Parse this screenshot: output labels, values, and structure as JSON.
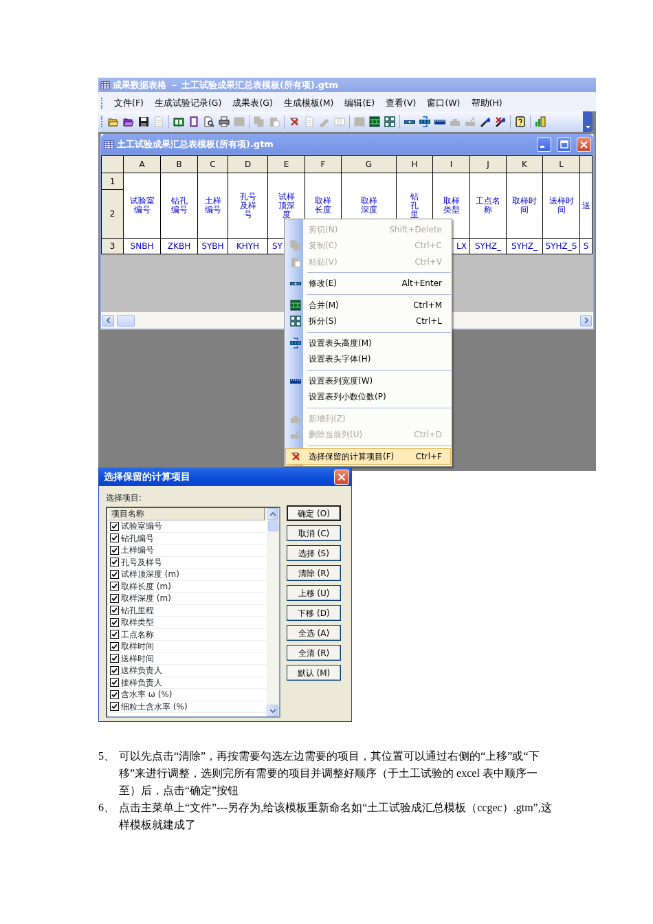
{
  "window": {
    "title": "成果数据表格 － 土工试验成果汇总表模板(所有项).gtm"
  },
  "menu_bar": [
    "文件(F)",
    "生成试验记录(G)",
    "成果表(G)",
    "生成模板(M)",
    "编辑(E)",
    "查看(V)",
    "窗口(W)",
    "帮助(H)"
  ],
  "toolbar": [
    {
      "kind": "button",
      "disabled": false
    },
    {
      "kind": "button",
      "disabled": false
    },
    {
      "kind": "button",
      "disabled": false
    },
    {
      "kind": "button",
      "disabled": true
    },
    {
      "kind": "separator"
    },
    {
      "kind": "button",
      "disabled": false
    },
    {
      "kind": "button",
      "disabled": false
    },
    {
      "kind": "button",
      "disabled": false
    },
    {
      "kind": "button",
      "disabled": false
    },
    {
      "kind": "button",
      "disabled": true
    },
    {
      "kind": "separator"
    },
    {
      "kind": "button",
      "disabled": true
    },
    {
      "kind": "button",
      "disabled": true
    },
    {
      "kind": "separator"
    },
    {
      "kind": "button",
      "disabled": false
    },
    {
      "kind": "button",
      "disabled": true
    },
    {
      "kind": "button",
      "disabled": true
    },
    {
      "kind": "button",
      "disabled": true
    },
    {
      "kind": "separator"
    },
    {
      "kind": "button",
      "disabled": true
    },
    {
      "kind": "button",
      "disabled": false
    },
    {
      "kind": "button",
      "disabled": false
    },
    {
      "kind": "separator"
    },
    {
      "kind": "button",
      "disabled": false
    },
    {
      "kind": "button",
      "disabled": false
    },
    {
      "kind": "button",
      "disabled": false
    },
    {
      "kind": "button",
      "disabled": true
    },
    {
      "kind": "button",
      "disabled": true
    },
    {
      "kind": "button",
      "disabled": false
    },
    {
      "kind": "button",
      "disabled": false
    },
    {
      "kind": "separator"
    },
    {
      "kind": "button",
      "disabled": false
    },
    {
      "kind": "separator"
    },
    {
      "kind": "button",
      "disabled": false
    }
  ],
  "document_window": {
    "title": "土工试验成果汇总表模板(所有项).gtm",
    "grid": {
      "column_letters": [
        "A",
        "B",
        "C",
        "D",
        "E",
        "F",
        "G",
        "H",
        "I",
        "J",
        "K",
        "L"
      ],
      "row_numbers": [
        "1",
        "2",
        "3"
      ],
      "header_cells": [
        "试验室编号",
        "钻孔编号",
        "土样编号",
        "孔号及样号",
        "试样顶深度",
        "取样长度",
        "取样深度",
        "钻孔里",
        "取样类型",
        "工点名称",
        "取样时间",
        "送样时间",
        "送"
      ],
      "row_3": {
        "A": "SNBH",
        "B": "ZKBH",
        "C": "SYBH",
        "D": "KHYH",
        "E": "SY",
        "I": "LX",
        "J": "SYHZ_",
        "K": "SYHZ_",
        "L": "SYHZ_S",
        "column_13": "S"
      }
    }
  },
  "context_menu": [
    {
      "kind": "item",
      "label": "剪切(N)",
      "shortcut": "Shift+Delete",
      "disabled": true,
      "selected": false
    },
    {
      "kind": "item",
      "label": "复制(C)",
      "shortcut": "Ctrl+C",
      "disabled": true,
      "selected": false
    },
    {
      "kind": "item",
      "label": "粘贴(V)",
      "shortcut": "Ctrl+V",
      "disabled": true,
      "selected": false
    },
    {
      "kind": "separator"
    },
    {
      "kind": "item",
      "label": "修改(E)",
      "shortcut": "Alt+Enter",
      "disabled": false,
      "selected": false
    },
    {
      "kind": "separator"
    },
    {
      "kind": "item",
      "label": "合并(M)",
      "shortcut": "Ctrl+M",
      "disabled": false,
      "selected": false
    },
    {
      "kind": "item",
      "label": "拆分(S)",
      "shortcut": "Ctrl+L",
      "disabled": false,
      "selected": false
    },
    {
      "kind": "separator"
    },
    {
      "kind": "item",
      "label": "设置表头高度(M)",
      "disabled": false,
      "selected": false
    },
    {
      "kind": "item",
      "label": "设置表头字体(H)",
      "disabled": false,
      "selected": false
    },
    {
      "kind": "separator"
    },
    {
      "kind": "item",
      "label": "设置表列宽度(W)",
      "disabled": false,
      "selected": false
    },
    {
      "kind": "item",
      "label": "设置表列小数位数(P)",
      "disabled": false,
      "selected": false
    },
    {
      "kind": "separator"
    },
    {
      "kind": "item",
      "label": "新增列(Z)",
      "disabled": true,
      "selected": false
    },
    {
      "kind": "item",
      "label": "删除当前列(U)",
      "shortcut": "Ctrl+D",
      "disabled": true,
      "selected": false
    },
    {
      "kind": "separator"
    },
    {
      "kind": "item",
      "label": "选择保留的计算项目(F)",
      "shortcut": "Ctrl+F",
      "disabled": false,
      "selected": true
    }
  ],
  "dialog": {
    "title": "选择保留的计算项目",
    "prompt": "选择项目:",
    "list_header": "项目名称",
    "items": [
      {
        "label": "试验室编号",
        "checked": true
      },
      {
        "label": "钻孔编号",
        "checked": true
      },
      {
        "label": "土样编号",
        "checked": true
      },
      {
        "label": "孔号及样号",
        "checked": true
      },
      {
        "label": "试样顶深度 (m)",
        "checked": true
      },
      {
        "label": "取样长度 (m)",
        "checked": true
      },
      {
        "label": "取样深度 (m)",
        "checked": true
      },
      {
        "label": "钻孔里程",
        "checked": true
      },
      {
        "label": "取样类型",
        "checked": true
      },
      {
        "label": "工点名称",
        "checked": true
      },
      {
        "label": "取样时间",
        "checked": true
      },
      {
        "label": "送样时间",
        "checked": true
      },
      {
        "label": "送样负责人",
        "checked": true
      },
      {
        "label": "接样负责人",
        "checked": true
      },
      {
        "label": "含水率 ω (%)",
        "checked": true
      },
      {
        "label": "细粒土含水率 (%)",
        "checked": true
      }
    ],
    "buttons": [
      {
        "label": "确定 (O)",
        "default": true
      },
      {
        "label": "取消 (C)",
        "default": false
      },
      {
        "label": "选择 (S)",
        "default": false
      },
      {
        "label": "清除 (R)",
        "default": false
      },
      {
        "label": "上移 (U)",
        "default": false
      },
      {
        "label": "下移 (D)",
        "default": false
      },
      {
        "label": "全选 (A)",
        "default": false
      },
      {
        "label": "全清 (R)",
        "default": false
      },
      {
        "label": "默认 (M)",
        "default": false
      }
    ]
  },
  "steps": [
    {
      "number": "5、",
      "text": "可以先点击“清除”，再按需要勾选左边需要的项目，其位置可以通过右侧的“上移”或“下移”来进行调整，选则完所有需要的项目并调整好顺序（于土工试验的 excel 表中顺序一至）后，点击“确定”按钮"
    },
    {
      "number": "6、",
      "text": "点击主菜单上“文件”---另存为,给该模板重新命名如“土工试验成汇总模板（ccgec）.gtm”,这样模板就建成了"
    }
  ]
}
